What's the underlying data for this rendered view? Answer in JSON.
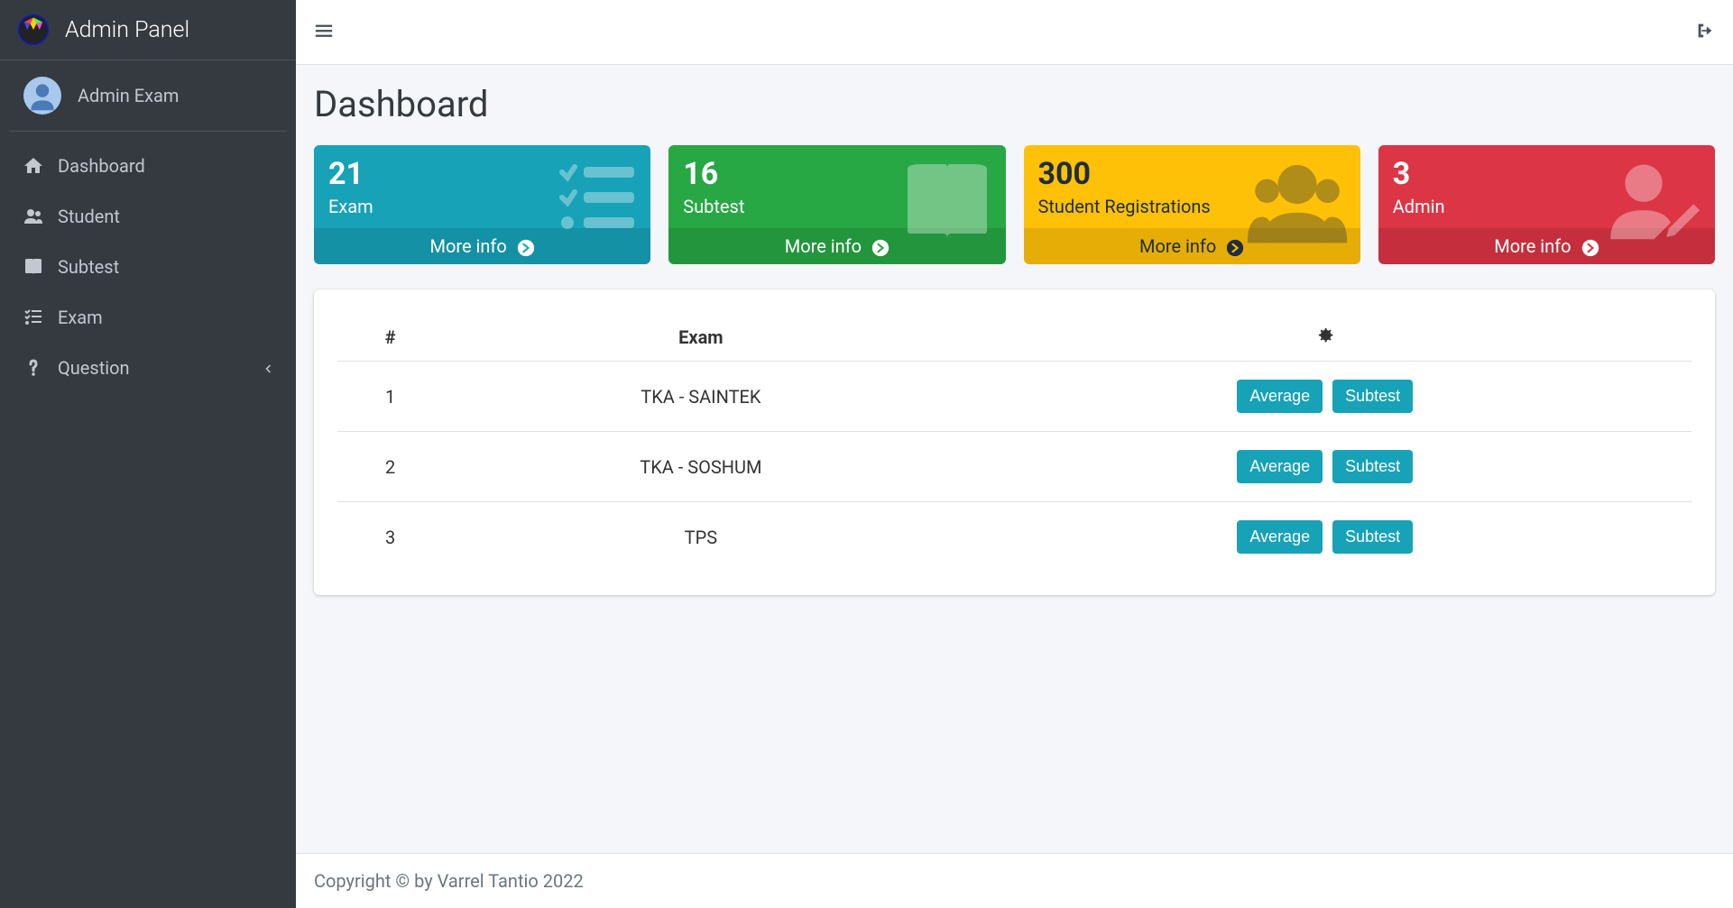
{
  "brand": {
    "title": "Admin Panel"
  },
  "user": {
    "name": "Admin Exam"
  },
  "sidebar": {
    "items": [
      {
        "label": "Dashboard"
      },
      {
        "label": "Student"
      },
      {
        "label": "Subtest"
      },
      {
        "label": "Exam"
      },
      {
        "label": "Question"
      }
    ]
  },
  "page": {
    "title": "Dashboard"
  },
  "stats": [
    {
      "value": "21",
      "label": "Exam",
      "footer": "More info"
    },
    {
      "value": "16",
      "label": "Subtest",
      "footer": "More info"
    },
    {
      "value": "300",
      "label": "Student Registrations",
      "footer": "More info"
    },
    {
      "value": "3",
      "label": "Admin",
      "footer": "More info"
    }
  ],
  "table": {
    "headers": {
      "index": "#",
      "exam": "Exam"
    },
    "rows": [
      {
        "index": "1",
        "name": "TKA - SAINTEK",
        "btn1": "Average",
        "btn2": "Subtest"
      },
      {
        "index": "2",
        "name": "TKA - SOSHUM",
        "btn1": "Average",
        "btn2": "Subtest"
      },
      {
        "index": "3",
        "name": "TPS",
        "btn1": "Average",
        "btn2": "Subtest"
      }
    ]
  },
  "footer": {
    "text": "Copyright © by Varrel Tantio 2022"
  }
}
